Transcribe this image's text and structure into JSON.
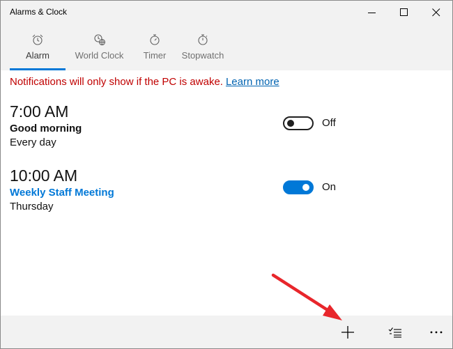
{
  "window": {
    "title": "Alarms & Clock",
    "controls": [
      "minimize-icon",
      "maximize-icon",
      "close-icon"
    ]
  },
  "tabs": [
    {
      "label": "Alarm",
      "icon": "alarm-clock-icon",
      "active": true
    },
    {
      "label": "World Clock",
      "icon": "world-clock-icon",
      "active": false
    },
    {
      "label": "Timer",
      "icon": "timer-icon",
      "active": false
    },
    {
      "label": "Stopwatch",
      "icon": "stopwatch-icon",
      "active": false
    }
  ],
  "notice": {
    "text": "Notifications will only show if the PC is awake.",
    "link": "Learn more"
  },
  "alarms": [
    {
      "time": "7:00 AM",
      "name": "Good morning",
      "days": "Every day",
      "enabled": false,
      "state_label": "Off"
    },
    {
      "time": "10:00 AM",
      "name": "Weekly Staff Meeting",
      "days": "Thursday",
      "enabled": true,
      "state_label": "On"
    }
  ],
  "bottom_bar": {
    "buttons": [
      "add-icon",
      "select-icon",
      "more-icon"
    ]
  },
  "colors": {
    "accent": "#0078d7",
    "notice": "#c00000",
    "link": "#0063b1",
    "annotation_arrow": "#e8262b"
  }
}
